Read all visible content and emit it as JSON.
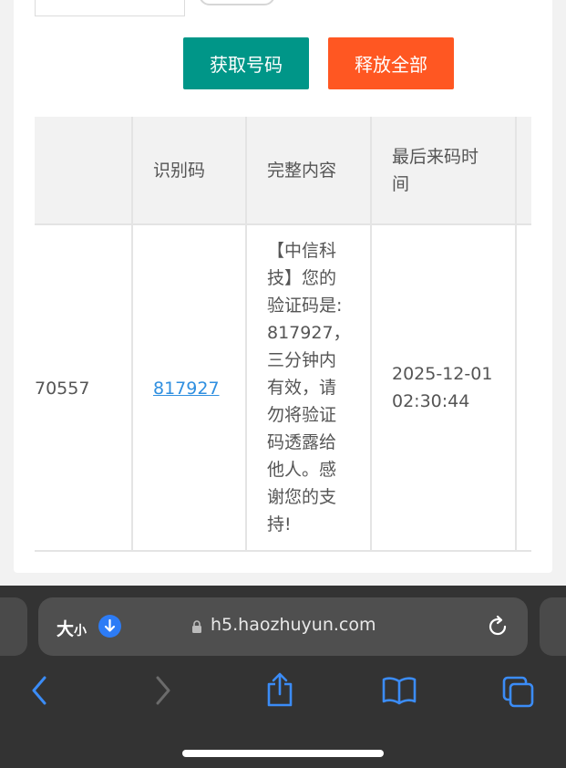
{
  "buttons": {
    "get_number": "获取号码",
    "release_all": "释放全部"
  },
  "table": {
    "headers": [
      "识别码",
      "完整内容",
      "最后来码时间"
    ],
    "header_line2": "间",
    "header_line1": "最后来码时",
    "row": {
      "number_partial": "70557",
      "code": "817927",
      "content_lines": [
        "【中信科",
        "技】您的",
        "验证码是:",
        "817927，",
        "三分钟内",
        "有效，请",
        "勿将验证",
        "码透露给",
        "他人。感",
        "谢您的支",
        "持!"
      ],
      "time_date": "2025-12-01",
      "time_clock": "02:30:44"
    }
  },
  "browser": {
    "text_size_big": "大",
    "text_size_small": "小",
    "url": "h5.haozhuyun.com"
  },
  "colors": {
    "primary": "#009688",
    "danger": "#ff5722",
    "link": "#2f8fe0",
    "safari_blue": "#2d7cf6"
  }
}
